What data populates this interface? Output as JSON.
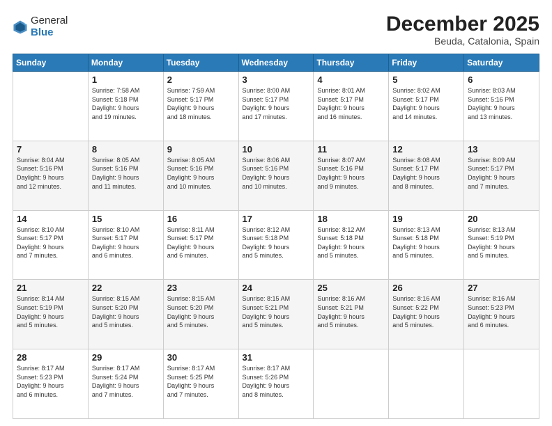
{
  "logo": {
    "general": "General",
    "blue": "Blue"
  },
  "header": {
    "month_year": "December 2025",
    "location": "Beuda, Catalonia, Spain"
  },
  "days_of_week": [
    "Sunday",
    "Monday",
    "Tuesday",
    "Wednesday",
    "Thursday",
    "Friday",
    "Saturday"
  ],
  "weeks": [
    [
      {
        "day": "",
        "info": ""
      },
      {
        "day": "1",
        "info": "Sunrise: 7:58 AM\nSunset: 5:18 PM\nDaylight: 9 hours\nand 19 minutes."
      },
      {
        "day": "2",
        "info": "Sunrise: 7:59 AM\nSunset: 5:17 PM\nDaylight: 9 hours\nand 18 minutes."
      },
      {
        "day": "3",
        "info": "Sunrise: 8:00 AM\nSunset: 5:17 PM\nDaylight: 9 hours\nand 17 minutes."
      },
      {
        "day": "4",
        "info": "Sunrise: 8:01 AM\nSunset: 5:17 PM\nDaylight: 9 hours\nand 16 minutes."
      },
      {
        "day": "5",
        "info": "Sunrise: 8:02 AM\nSunset: 5:17 PM\nDaylight: 9 hours\nand 14 minutes."
      },
      {
        "day": "6",
        "info": "Sunrise: 8:03 AM\nSunset: 5:16 PM\nDaylight: 9 hours\nand 13 minutes."
      }
    ],
    [
      {
        "day": "7",
        "info": "Sunrise: 8:04 AM\nSunset: 5:16 PM\nDaylight: 9 hours\nand 12 minutes."
      },
      {
        "day": "8",
        "info": "Sunrise: 8:05 AM\nSunset: 5:16 PM\nDaylight: 9 hours\nand 11 minutes."
      },
      {
        "day": "9",
        "info": "Sunrise: 8:05 AM\nSunset: 5:16 PM\nDaylight: 9 hours\nand 10 minutes."
      },
      {
        "day": "10",
        "info": "Sunrise: 8:06 AM\nSunset: 5:16 PM\nDaylight: 9 hours\nand 10 minutes."
      },
      {
        "day": "11",
        "info": "Sunrise: 8:07 AM\nSunset: 5:16 PM\nDaylight: 9 hours\nand 9 minutes."
      },
      {
        "day": "12",
        "info": "Sunrise: 8:08 AM\nSunset: 5:17 PM\nDaylight: 9 hours\nand 8 minutes."
      },
      {
        "day": "13",
        "info": "Sunrise: 8:09 AM\nSunset: 5:17 PM\nDaylight: 9 hours\nand 7 minutes."
      }
    ],
    [
      {
        "day": "14",
        "info": "Sunrise: 8:10 AM\nSunset: 5:17 PM\nDaylight: 9 hours\nand 7 minutes."
      },
      {
        "day": "15",
        "info": "Sunrise: 8:10 AM\nSunset: 5:17 PM\nDaylight: 9 hours\nand 6 minutes."
      },
      {
        "day": "16",
        "info": "Sunrise: 8:11 AM\nSunset: 5:17 PM\nDaylight: 9 hours\nand 6 minutes."
      },
      {
        "day": "17",
        "info": "Sunrise: 8:12 AM\nSunset: 5:18 PM\nDaylight: 9 hours\nand 5 minutes."
      },
      {
        "day": "18",
        "info": "Sunrise: 8:12 AM\nSunset: 5:18 PM\nDaylight: 9 hours\nand 5 minutes."
      },
      {
        "day": "19",
        "info": "Sunrise: 8:13 AM\nSunset: 5:18 PM\nDaylight: 9 hours\nand 5 minutes."
      },
      {
        "day": "20",
        "info": "Sunrise: 8:13 AM\nSunset: 5:19 PM\nDaylight: 9 hours\nand 5 minutes."
      }
    ],
    [
      {
        "day": "21",
        "info": "Sunrise: 8:14 AM\nSunset: 5:19 PM\nDaylight: 9 hours\nand 5 minutes."
      },
      {
        "day": "22",
        "info": "Sunrise: 8:15 AM\nSunset: 5:20 PM\nDaylight: 9 hours\nand 5 minutes."
      },
      {
        "day": "23",
        "info": "Sunrise: 8:15 AM\nSunset: 5:20 PM\nDaylight: 9 hours\nand 5 minutes."
      },
      {
        "day": "24",
        "info": "Sunrise: 8:15 AM\nSunset: 5:21 PM\nDaylight: 9 hours\nand 5 minutes."
      },
      {
        "day": "25",
        "info": "Sunrise: 8:16 AM\nSunset: 5:21 PM\nDaylight: 9 hours\nand 5 minutes."
      },
      {
        "day": "26",
        "info": "Sunrise: 8:16 AM\nSunset: 5:22 PM\nDaylight: 9 hours\nand 5 minutes."
      },
      {
        "day": "27",
        "info": "Sunrise: 8:16 AM\nSunset: 5:23 PM\nDaylight: 9 hours\nand 6 minutes."
      }
    ],
    [
      {
        "day": "28",
        "info": "Sunrise: 8:17 AM\nSunset: 5:23 PM\nDaylight: 9 hours\nand 6 minutes."
      },
      {
        "day": "29",
        "info": "Sunrise: 8:17 AM\nSunset: 5:24 PM\nDaylight: 9 hours\nand 7 minutes."
      },
      {
        "day": "30",
        "info": "Sunrise: 8:17 AM\nSunset: 5:25 PM\nDaylight: 9 hours\nand 7 minutes."
      },
      {
        "day": "31",
        "info": "Sunrise: 8:17 AM\nSunset: 5:26 PM\nDaylight: 9 hours\nand 8 minutes."
      },
      {
        "day": "",
        "info": ""
      },
      {
        "day": "",
        "info": ""
      },
      {
        "day": "",
        "info": ""
      }
    ]
  ]
}
